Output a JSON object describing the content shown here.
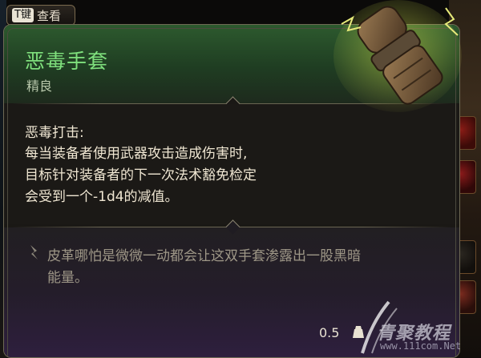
{
  "top_button": {
    "key": "T键",
    "label": "查看"
  },
  "item": {
    "name": "恶毒手套",
    "rarity": "精良",
    "name_color": "#7fe07d"
  },
  "passive": {
    "name": "恶毒打击:",
    "description_lines": [
      "每当装备者使用武器攻击造成伤害时,",
      "目标针对装备者的下一次法术豁免检定",
      "会受到一个-1d4的减值。"
    ]
  },
  "flavor": {
    "icon": "feather-icon",
    "lines": [
      "皮革哪怕是微微一动都会让这双手套渗露出一股黑暗",
      "能量。"
    ]
  },
  "footer": {
    "weight_value": "0.5",
    "weight_icon": "weight-icon"
  },
  "watermark": {
    "text": "青聚教程",
    "url": "www.111com.Net"
  }
}
